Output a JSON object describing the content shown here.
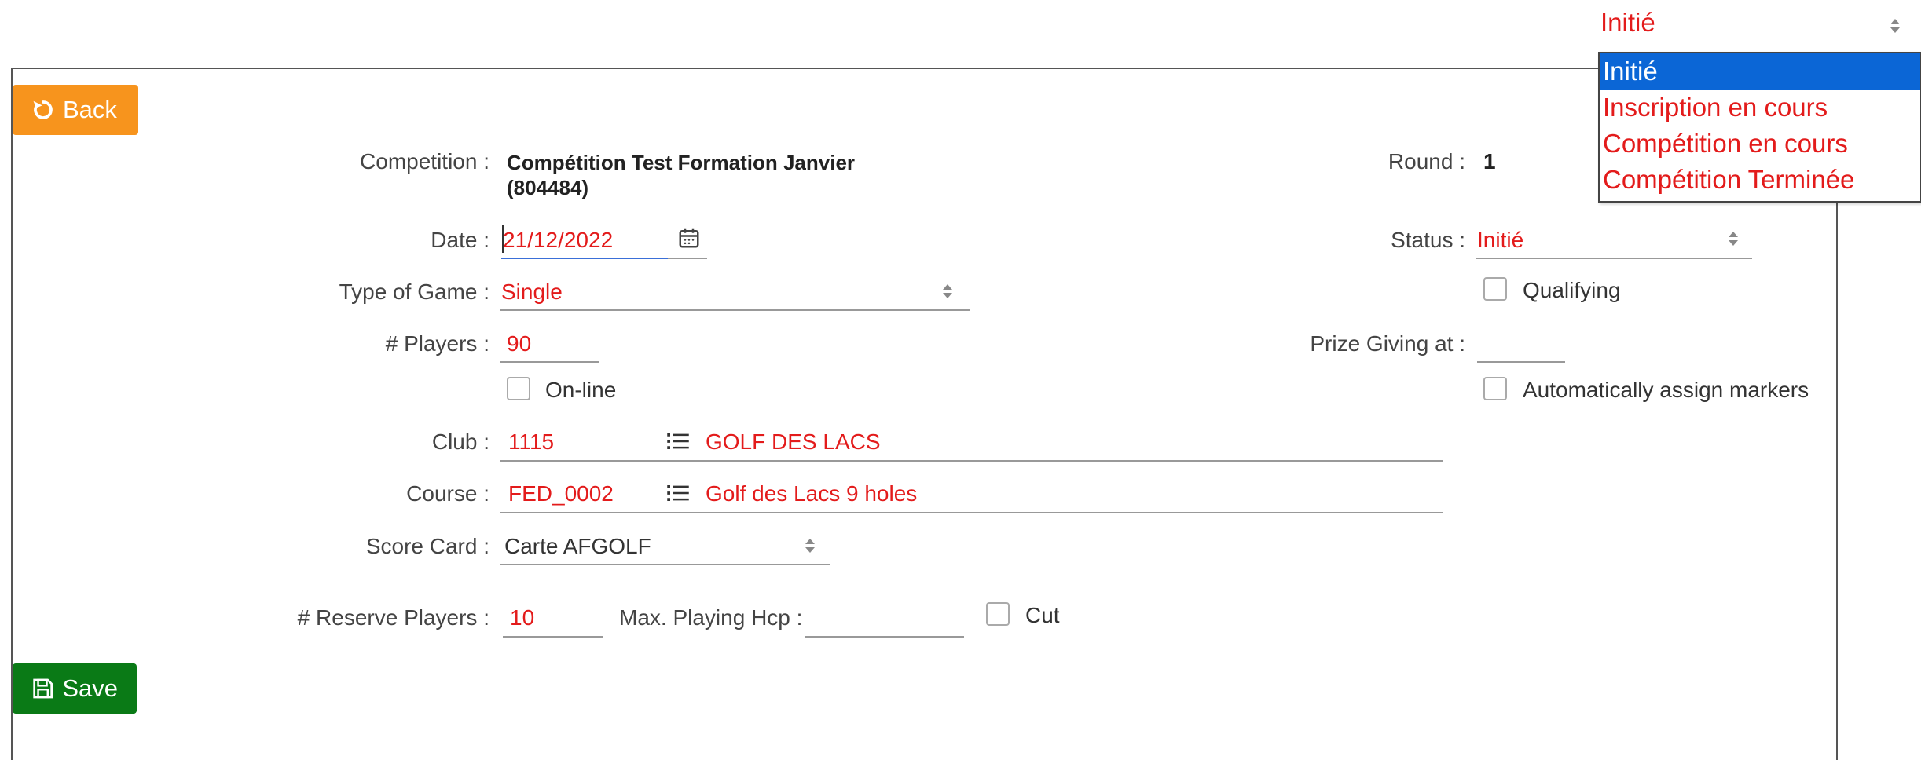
{
  "buttons": {
    "back_label": "Back",
    "save_label": "Save"
  },
  "status_dropdown": {
    "current": "Initié",
    "options": [
      "Initié",
      "Inscription en cours",
      "Compétition en cours",
      "Compétition Terminée"
    ],
    "selected_index": 0
  },
  "form": {
    "competition_label": "Competition :",
    "competition_value_line1": "Compétition Test Formation Janvier",
    "competition_value_line2": "(804484)",
    "round_label": "Round :",
    "round_value": "1",
    "date_label": "Date :",
    "date_value": "21/12/2022",
    "status_label": "Status :",
    "status_value": "Initié",
    "type_label": "Type of Game :",
    "type_value": "Single",
    "qualifying_label": "Qualifying",
    "players_label": "# Players :",
    "players_value": "90",
    "prize_label": "Prize Giving at :",
    "prize_value": "",
    "online_label": "On-line",
    "auto_markers_label": "Automatically assign markers",
    "club_label": "Club :",
    "club_code": "1115",
    "club_name": "GOLF DES LACS",
    "course_label": "Course :",
    "course_code": "FED_0002",
    "course_name": "Golf des Lacs 9 holes",
    "scorecard_label": "Score Card :",
    "scorecard_value": "Carte AFGOLF",
    "reserve_label": "# Reserve Players :",
    "reserve_value": "10",
    "maxhcp_label": "Max. Playing Hcp :",
    "maxhcp_value": "",
    "cut_label": "Cut"
  },
  "colors": {
    "accent_red": "#e31b1b",
    "back_orange": "#f7941d",
    "save_green": "#0a7a16",
    "select_blue": "#0b66d6"
  }
}
